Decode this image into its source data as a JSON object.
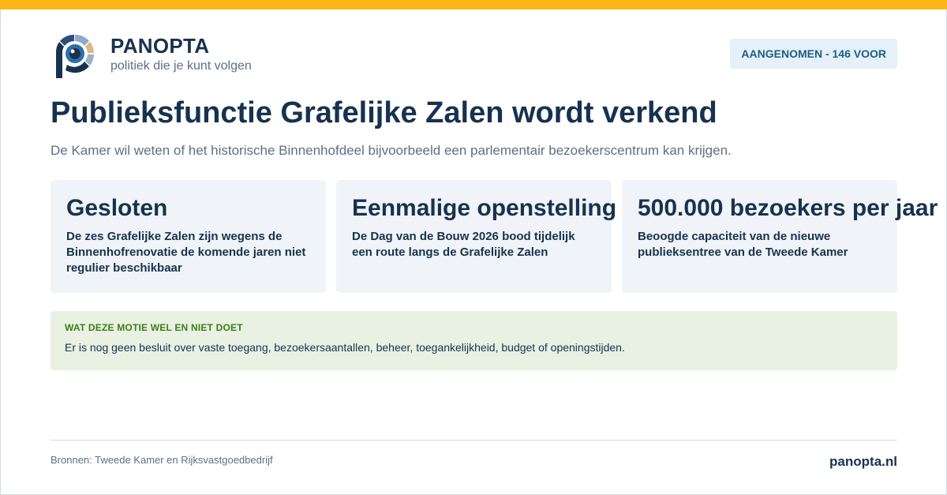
{
  "brand": {
    "name": "PANOPTA",
    "tagline": "politiek die je kunt volgen",
    "logo_icon": "eye-p-logo-icon"
  },
  "status": {
    "badge": "AANGENOMEN - 146 VOOR"
  },
  "headline": {
    "title": "Publieksfunctie Grafelijke Zalen wordt verkend",
    "subtitle": "De Kamer wil weten of het historische Binnenhofdeel bijvoorbeeld een parlementair bezoekerscentrum kan krijgen."
  },
  "cards": [
    {
      "heading": "Gesloten",
      "text": "De zes Grafelijke Zalen zijn wegens de Binnenhofrenovatie de komende jaren niet regulier beschikbaar"
    },
    {
      "heading": "Eenmalige openstelling",
      "text": "De Dag van de Bouw 2026 bood tijdelijk een route langs de Grafelijke Zalen"
    },
    {
      "heading": "500.000 bezoekers per jaar",
      "text": "Beoogde capaciteit van de nieuwe publieksentree van de Tweede Kamer"
    }
  ],
  "note": {
    "label": "WAT DEZE MOTIE WEL EN NIET DOET",
    "text": "Er is nog geen besluit over vaste toegang, bezoekersaantallen, beheer, toegankelijkheid, budget of openingstijden."
  },
  "footer": {
    "sources": "Bronnen: Tweede Kamer en Rijksvastgoedbedrijf",
    "site": "panopta.nl"
  },
  "colors": {
    "accent_bar": "#fbb716",
    "brand_navy": "#17324f",
    "badge_bg": "#e6f0f8",
    "note_bg": "#e8f1e2",
    "note_label": "#3e7d17"
  }
}
